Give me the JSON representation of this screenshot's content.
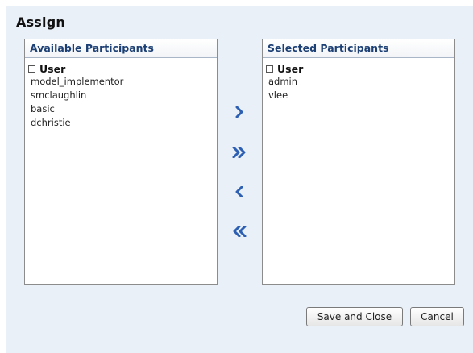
{
  "dialog": {
    "title": "Assign"
  },
  "available": {
    "header": "Available Participants",
    "group_label": "User",
    "items": [
      "model_implementor",
      "smclaughlin",
      "basic",
      "dchristie"
    ]
  },
  "selected": {
    "header": "Selected Participants",
    "group_label": "User",
    "items": [
      "admin",
      "vlee"
    ]
  },
  "shuttle": {
    "move": "move-right-icon",
    "move_all": "move-all-right-icon",
    "remove": "move-left-icon",
    "remove_all": "move-all-left-icon",
    "icon_color": "#2d5fb3"
  },
  "buttons": {
    "save_label": "Save and Close",
    "cancel_label": "Cancel"
  },
  "colors": {
    "dialog_background": "#eaf0f8",
    "header_text": "#1c3f74"
  }
}
